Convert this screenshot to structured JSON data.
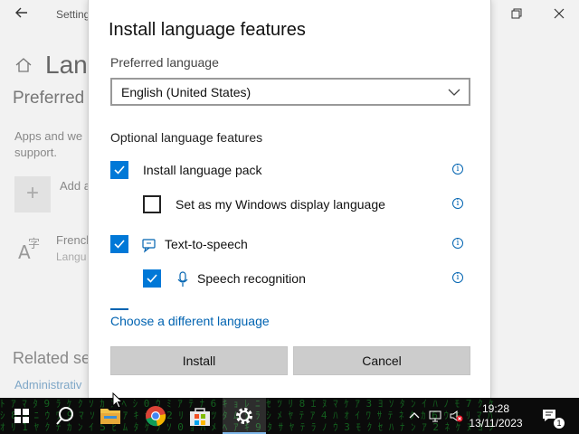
{
  "settings_bg": {
    "window_title": "Setting",
    "page_heading": "Lang",
    "section_heading": "Preferred",
    "description": "Apps and we support.",
    "add_label": "Add a",
    "language_name": "French",
    "language_sub": "Langu",
    "related_heading": "Related se",
    "related_link": "Administrativ"
  },
  "dialog": {
    "title": "Install language features",
    "preferred_label": "Preferred language",
    "preferred_value": "English (United States)",
    "optional_label": "Optional language features",
    "features": [
      {
        "label": "Install language pack",
        "checked": true
      },
      {
        "label": "Set as my Windows display language",
        "checked": false
      },
      {
        "label": "Text-to-speech",
        "checked": true,
        "icon": "text-to-speech-icon"
      },
      {
        "label": "Speech recognition",
        "checked": true,
        "icon": "microphone-icon"
      }
    ],
    "info_glyph": "i",
    "different_language_link": "Choose a different language",
    "install_button": "Install",
    "cancel_button": "Cancel"
  },
  "taskbar": {
    "time": "19:28",
    "date": "13/11/2023",
    "notification_count": "1",
    "pinned": [
      "start-icon",
      "search-icon",
      "file-explorer-icon",
      "chrome-icon",
      "store-icon",
      "settings-icon"
    ],
    "active_app": "settings-icon"
  },
  "colors": {
    "accent": "#0078d7",
    "link": "#0063b1",
    "button_bg": "#cccccc",
    "taskbar_bg": "#0b0b0b",
    "matrix_green": "#1aa32e"
  }
}
